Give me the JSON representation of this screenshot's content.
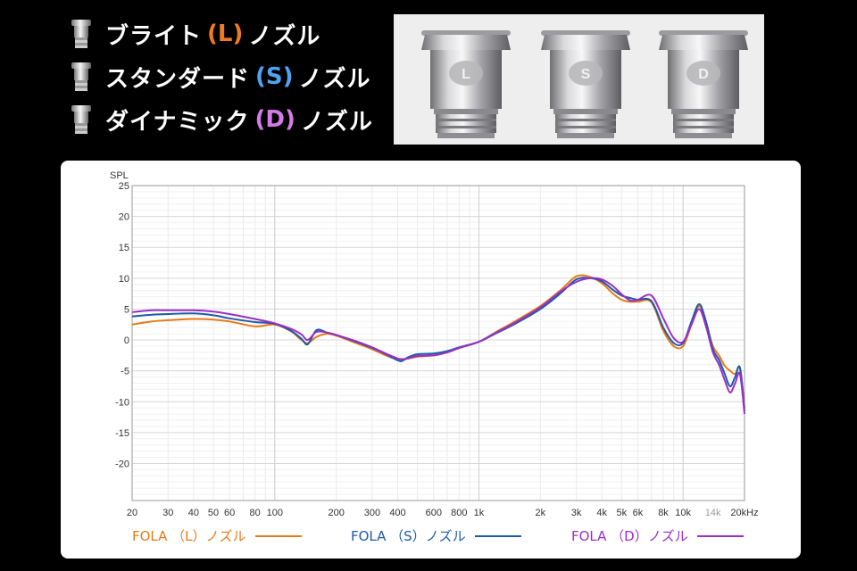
{
  "header": {
    "nozzles": [
      {
        "prefix": "ブライト",
        "code": "(L)",
        "suffix": "ノズル",
        "color": "#f07a21"
      },
      {
        "prefix": "スタンダード",
        "code": "(S)",
        "suffix": "ノズル",
        "color": "#4fa3f0"
      },
      {
        "prefix": "ダイナミック",
        "code": "(D)",
        "suffix": "ノズル",
        "color": "#d37be6"
      }
    ]
  },
  "photo": {
    "letters": [
      "L",
      "S",
      "D"
    ],
    "icon": "nozzle-icon"
  },
  "chart_data": {
    "type": "line",
    "ylabel": "SPL",
    "x_scale": "log",
    "xlim": [
      20,
      20000
    ],
    "ylim": [
      -26,
      25
    ],
    "grid": true,
    "legend_position": "bottom",
    "x_tick_labels": [
      {
        "value": 20,
        "label": "20"
      },
      {
        "value": 30,
        "label": "30"
      },
      {
        "value": 40,
        "label": "40"
      },
      {
        "value": 50,
        "label": "50"
      },
      {
        "value": 60,
        "label": "60"
      },
      {
        "value": 80,
        "label": "80"
      },
      {
        "value": 100,
        "label": "100"
      },
      {
        "value": 200,
        "label": "200"
      },
      {
        "value": 300,
        "label": "300"
      },
      {
        "value": 400,
        "label": "400"
      },
      {
        "value": 600,
        "label": "600"
      },
      {
        "value": 800,
        "label": "800"
      },
      {
        "value": 1000,
        "label": "1k"
      },
      {
        "value": 2000,
        "label": "2k"
      },
      {
        "value": 3000,
        "label": "3k"
      },
      {
        "value": 4000,
        "label": "4k"
      },
      {
        "value": 5000,
        "label": "5k"
      },
      {
        "value": 6000,
        "label": "6k"
      },
      {
        "value": 8000,
        "label": "8k"
      },
      {
        "value": 10000,
        "label": "10k"
      },
      {
        "value": 14000,
        "label": "14k"
      },
      {
        "value": 20000,
        "label": "20kHz"
      }
    ],
    "y_ticks": [
      25,
      20,
      15,
      10,
      5,
      0,
      -5,
      -10,
      -15,
      -20
    ],
    "x": [
      20,
      25,
      30,
      40,
      50,
      60,
      80,
      100,
      120,
      135,
      145,
      160,
      180,
      200,
      250,
      300,
      350,
      400,
      420,
      450,
      500,
      600,
      700,
      800,
      1000,
      1200,
      1500,
      2000,
      2500,
      3000,
      3500,
      4000,
      4500,
      5000,
      5500,
      6000,
      7000,
      8000,
      9000,
      10000,
      11000,
      12000,
      13000,
      14000,
      15000,
      16000,
      17000,
      18000,
      19000,
      20000
    ],
    "series": [
      {
        "name": "FOLA （L）ノズル",
        "color": "#e57a18",
        "values": [
          2.5,
          3.0,
          3.2,
          3.4,
          3.3,
          3.0,
          2.2,
          2.5,
          1.4,
          0.0,
          -0.5,
          0.5,
          1.0,
          0.7,
          -0.5,
          -1.5,
          -2.5,
          -3.2,
          -3.3,
          -3.0,
          -2.7,
          -2.5,
          -2.0,
          -1.3,
          -0.3,
          1.2,
          3.0,
          5.5,
          8.0,
          10.3,
          10.2,
          9.2,
          7.6,
          6.5,
          6.2,
          6.2,
          6.1,
          1.5,
          -1.0,
          -1.0,
          2.5,
          5.5,
          2.5,
          -1.0,
          -2.5,
          -4.2,
          -5.0,
          -5.5,
          -4.5,
          -11.0
        ]
      },
      {
        "name": "FOLA （S）ノズル",
        "color": "#1f5aa8",
        "values": [
          3.8,
          4.1,
          4.2,
          4.3,
          4.0,
          3.5,
          2.9,
          2.6,
          1.5,
          0.2,
          -0.7,
          1.6,
          1.2,
          0.8,
          -0.3,
          -1.3,
          -2.3,
          -3.3,
          -3.4,
          -2.8,
          -2.3,
          -2.2,
          -1.8,
          -1.2,
          -0.3,
          1.0,
          2.6,
          5.0,
          7.5,
          9.8,
          10.0,
          9.5,
          8.2,
          7.2,
          6.8,
          6.5,
          6.3,
          2.0,
          -0.5,
          -0.5,
          3.0,
          5.8,
          2.8,
          -1.5,
          -3.2,
          -5.5,
          -7.5,
          -6.0,
          -4.5,
          -11.5
        ]
      },
      {
        "name": "FOLA （D）ノズル",
        "color": "#9a2fc6",
        "values": [
          4.5,
          4.8,
          4.8,
          4.8,
          4.6,
          4.2,
          3.4,
          2.7,
          1.8,
          0.9,
          0.0,
          1.3,
          1.2,
          0.8,
          -0.2,
          -1.2,
          -2.2,
          -3.0,
          -3.1,
          -3.0,
          -2.6,
          -2.5,
          -2.0,
          -1.3,
          -0.3,
          1.1,
          2.8,
          5.3,
          7.8,
          9.4,
          10.0,
          9.8,
          8.8,
          7.4,
          6.4,
          6.5,
          7.2,
          3.5,
          0.3,
          -0.3,
          2.5,
          5.0,
          2.0,
          -2.0,
          -4.0,
          -6.5,
          -8.5,
          -7.0,
          -5.5,
          -12.0
        ]
      }
    ]
  }
}
